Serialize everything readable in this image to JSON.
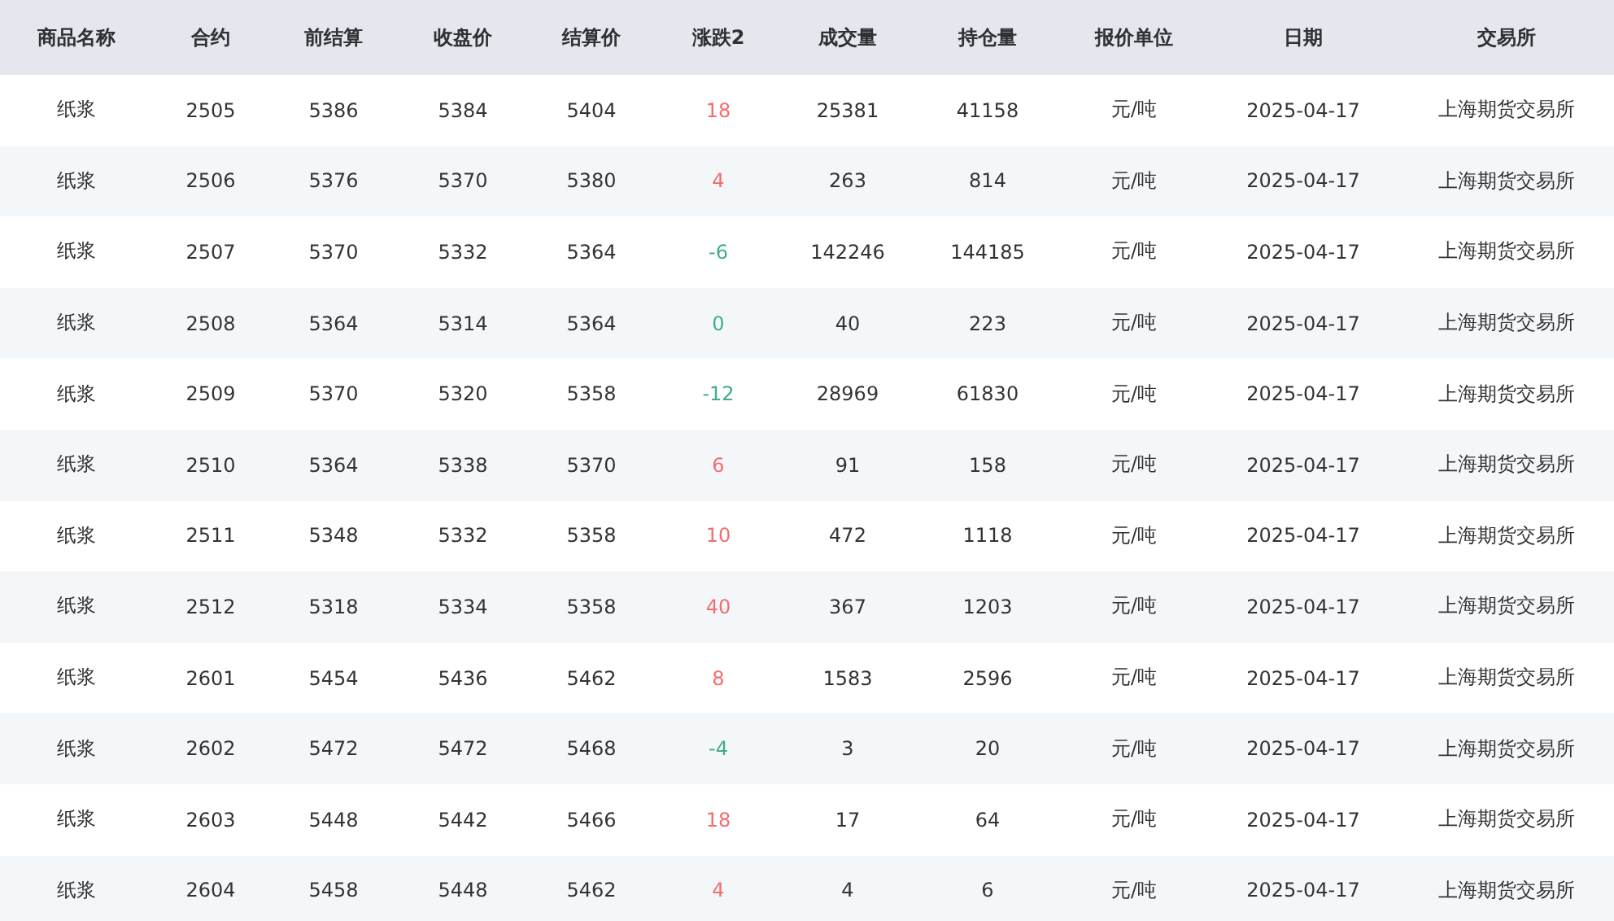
{
  "table": {
    "columns": [
      "商品名称",
      "合约",
      "前结算",
      "收盘价",
      "结算价",
      "涨跌2",
      "成交量",
      "持仓量",
      "报价单位",
      "日期",
      "交易所"
    ],
    "rows": [
      {
        "cells": [
          "纸浆",
          "2505",
          "5386",
          "5384",
          "5404",
          "18",
          "25381",
          "41158",
          "元/吨",
          "2025-04-17",
          "上海期货交易所"
        ],
        "color": "#f56c6c"
      },
      {
        "cells": [
          "纸浆",
          "2506",
          "5376",
          "5370",
          "5380",
          "4",
          "263",
          "814",
          "元/吨",
          "2025-04-17",
          "上海期货交易所"
        ],
        "color": "#f56c6c"
      },
      {
        "cells": [
          "纸浆",
          "2507",
          "5370",
          "5332",
          "5364",
          "-6",
          "142246",
          "144185",
          "元/吨",
          "2025-04-17",
          "上海期货交易所"
        ],
        "color": "#3fae84"
      },
      {
        "cells": [
          "纸浆",
          "2508",
          "5364",
          "5314",
          "5364",
          "0",
          "40",
          "223",
          "元/吨",
          "2025-04-17",
          "上海期货交易所"
        ],
        "color": "#3fae84"
      },
      {
        "cells": [
          "纸浆",
          "2509",
          "5370",
          "5320",
          "5358",
          "-12",
          "28969",
          "61830",
          "元/吨",
          "2025-04-17",
          "上海期货交易所"
        ],
        "color": "#3fae84"
      },
      {
        "cells": [
          "纸浆",
          "2510",
          "5364",
          "5338",
          "5370",
          "6",
          "91",
          "158",
          "元/吨",
          "2025-04-17",
          "上海期货交易所"
        ],
        "color": "#f56c6c"
      },
      {
        "cells": [
          "纸浆",
          "2511",
          "5348",
          "5332",
          "5358",
          "10",
          "472",
          "1118",
          "元/吨",
          "2025-04-17",
          "上海期货交易所"
        ],
        "color": "#f56c6c"
      },
      {
        "cells": [
          "纸浆",
          "2512",
          "5318",
          "5334",
          "5358",
          "40",
          "367",
          "1203",
          "元/吨",
          "2025-04-17",
          "上海期货交易所"
        ],
        "color": "#f56c6c"
      },
      {
        "cells": [
          "纸浆",
          "2601",
          "5454",
          "5436",
          "5462",
          "8",
          "1583",
          "2596",
          "元/吨",
          "2025-04-17",
          "上海期货交易所"
        ],
        "color": "#f56c6c"
      },
      {
        "cells": [
          "纸浆",
          "2602",
          "5472",
          "5472",
          "5468",
          "-4",
          "3",
          "20",
          "元/吨",
          "2025-04-17",
          "上海期货交易所"
        ],
        "color": "#3fae84"
      },
      {
        "cells": [
          "纸浆",
          "2603",
          "5448",
          "5442",
          "5466",
          "18",
          "17",
          "64",
          "元/吨",
          "2025-04-17",
          "上海期货交易所"
        ],
        "color": "#f56c6c"
      },
      {
        "cells": [
          "纸浆",
          "2604",
          "5458",
          "5448",
          "5462",
          "4",
          "4",
          "6",
          "元/吨",
          "2025-04-17",
          "上海期货交易所"
        ],
        "color": "#f56c6c"
      }
    ]
  }
}
